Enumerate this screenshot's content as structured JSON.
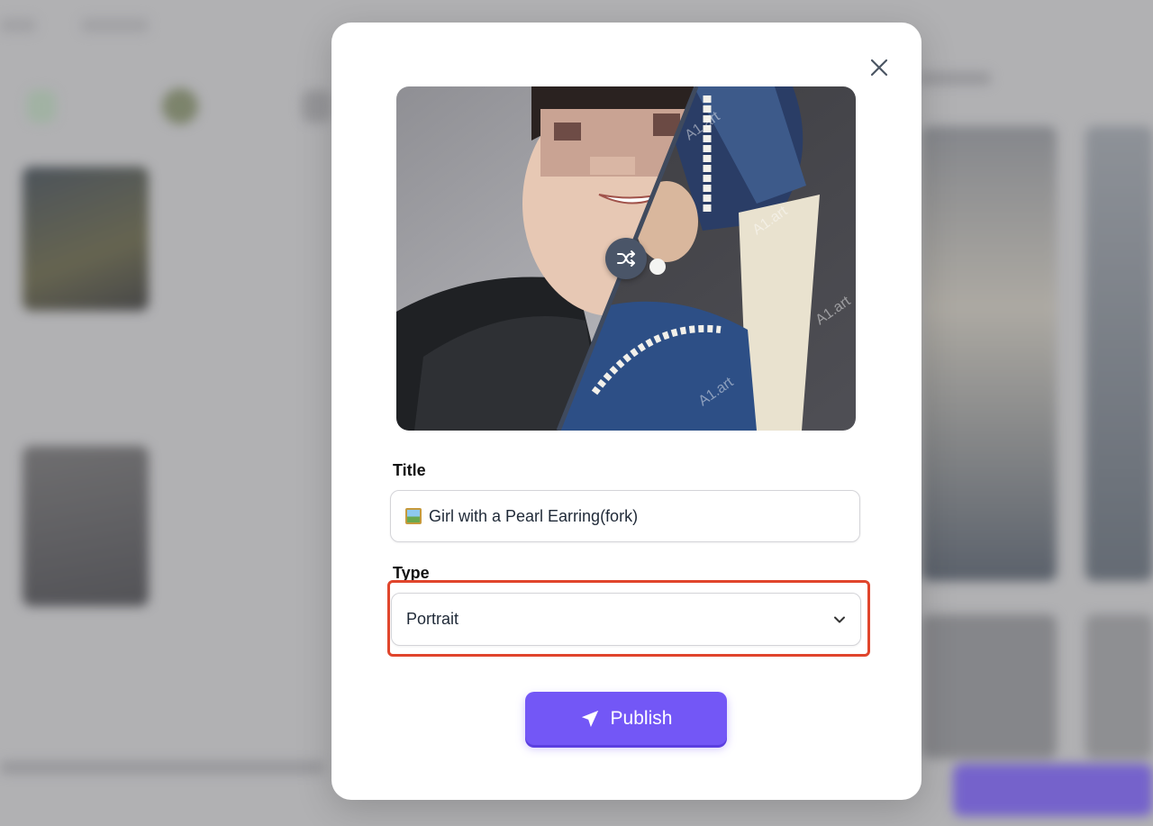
{
  "modal": {
    "title_label": "Title",
    "title_value": "Girl with a Pearl Earring(fork)",
    "type_label": "Type",
    "type_selected": "Portrait",
    "publish_label": "Publish"
  },
  "preview": {
    "watermarks": [
      "A1.art",
      "A1.art",
      "A1.art",
      "A1.art"
    ]
  },
  "colors": {
    "accent": "#7357f6",
    "highlight": "#e0452c",
    "swap_button": "#4a5568"
  },
  "icons": [
    "close-icon",
    "shuffle-icon",
    "chevron-down-icon",
    "send-icon",
    "framed-picture-icon"
  ]
}
